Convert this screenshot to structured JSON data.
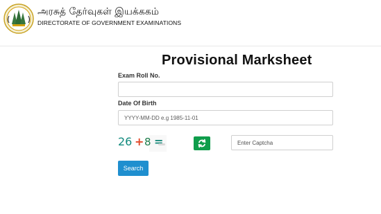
{
  "header": {
    "tamil_title": "அரசுத் தேர்வுகள் இயக்ககம்",
    "english_title": "DIRECTORATE OF GOVERNMENT EXAMINATIONS",
    "logo_icon": "tamil-nadu-emblem-icon",
    "logo_colors": [
      "#1f7a2f",
      "#d4a10f",
      "#ffffff",
      "#2f2f2f"
    ]
  },
  "main": {
    "page_title": "Provisional Marksheet",
    "exam_roll_label": "Exam Roll No.",
    "exam_roll_value": "",
    "dob_label": "Date Of Birth",
    "dob_placeholder": "YYYY-MM-DD e.g 1985-11-01",
    "dob_value": "",
    "captcha_chars": [
      "26",
      "+",
      "8",
      "="
    ],
    "captcha_input_placeholder": "Enter Captcha",
    "captcha_input_value": "",
    "refresh_icon": "refresh-icon",
    "search_label": "Search"
  },
  "colors": {
    "search_button": "#1f8fcf",
    "refresh_button": "#0f9d4b",
    "border": "#cfcfcf"
  }
}
